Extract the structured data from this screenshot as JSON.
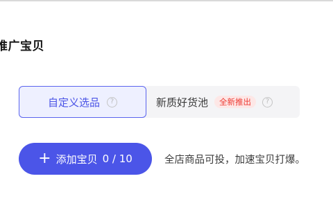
{
  "page": {
    "title": "推广宝贝"
  },
  "segment": {
    "options": [
      {
        "label": "自定义选品",
        "selected": true
      },
      {
        "label": "新质好货池",
        "badge": "全新推出",
        "selected": false
      }
    ]
  },
  "add_button": {
    "label": "添加宝贝",
    "count": "0 / 10"
  },
  "hint": "全店商品可投，加速宝贝打爆。",
  "icons": {
    "help": "question-circle-icon",
    "add": "plus-icon"
  },
  "colors": {
    "accent": "#4b55e8",
    "selected_bg": "#eef0ff",
    "badge_text": "#ee3a32",
    "badge_bg": "#fde7e6"
  }
}
